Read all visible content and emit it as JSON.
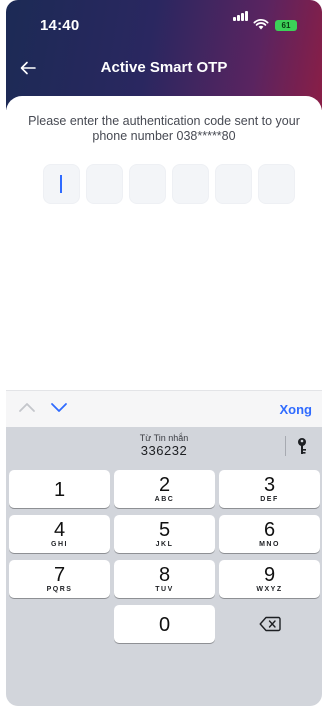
{
  "status_bar": {
    "time": "14:40",
    "battery": "61"
  },
  "header": {
    "title": "Active Smart OTP"
  },
  "body": {
    "instruction": "Please enter the authentication code sent to your phone number 038*****80"
  },
  "otp": {
    "length": 6,
    "values": [
      "",
      "",
      "",
      "",
      "",
      ""
    ]
  },
  "keyboard": {
    "done_label": "Xong",
    "suggestion": {
      "source": "Từ Tin nhắn",
      "code": "336232"
    },
    "keys": [
      {
        "num": "1",
        "letters": ""
      },
      {
        "num": "2",
        "letters": "ABC"
      },
      {
        "num": "3",
        "letters": "DEF"
      },
      {
        "num": "4",
        "letters": "GHI"
      },
      {
        "num": "5",
        "letters": "JKL"
      },
      {
        "num": "6",
        "letters": "MNO"
      },
      {
        "num": "7",
        "letters": "PQRS"
      },
      {
        "num": "8",
        "letters": "TUV"
      },
      {
        "num": "9",
        "letters": "WXYZ"
      },
      {
        "num": "0",
        "letters": ""
      }
    ]
  },
  "colors": {
    "accent": "#2f6bff",
    "header_start": "#1c2a55",
    "header_end": "#8a1e46"
  }
}
